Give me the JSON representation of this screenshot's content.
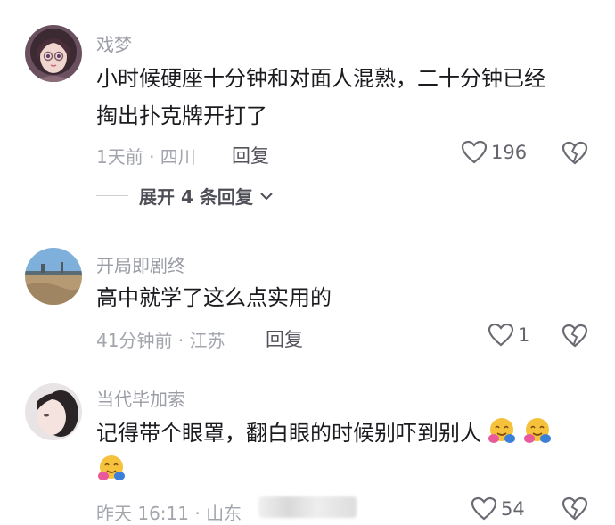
{
  "comments": [
    {
      "username": "戏梦",
      "text_lines": [
        "小时候硬座十分钟和对面人混熟，二十分钟已经",
        "掏出扑克牌开打了"
      ],
      "meta": "1天前 · 四川",
      "reply_label": "回复",
      "likes": "196",
      "expand_label": "展开 4 条回复",
      "avatar_icon": "anime-girl-avatar"
    },
    {
      "username": "开局即剧终",
      "text_lines": [
        "高中就学了这么点实用的"
      ],
      "meta": "41分钟前 · 江苏",
      "reply_label": "回复",
      "likes": "1",
      "avatar_icon": "landscape-avatar"
    },
    {
      "username": "当代毕加索",
      "text_lines": [
        "记得带个眼罩，翻白眼的时候别吓到别人"
      ],
      "meta": "昨天 16:11 · 山东",
      "likes": "54",
      "emoji_icon": "hugging-face-emoji",
      "avatar_icon": "selfie-avatar"
    }
  ],
  "colors": {
    "username": "#9a9ca6",
    "text": "#1b1b1f",
    "meta": "#a3a5ad"
  }
}
